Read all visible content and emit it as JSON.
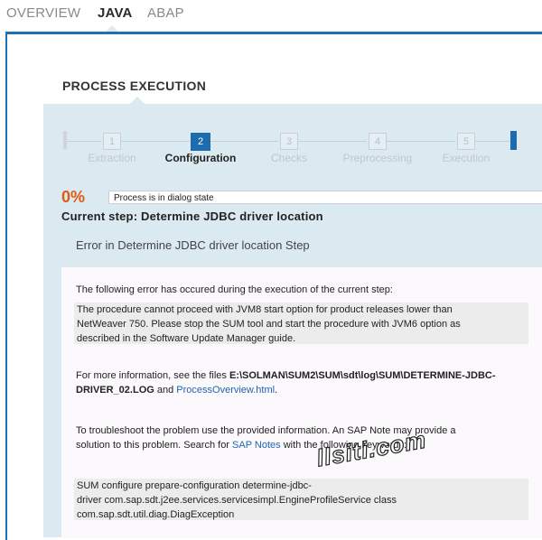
{
  "tabs": [
    {
      "label": "OVERVIEW",
      "active": false
    },
    {
      "label": "JAVA",
      "active": true
    },
    {
      "label": "ABAP",
      "active": false
    }
  ],
  "section_title": "PROCESS EXECUTION",
  "steps": [
    {
      "number": "1",
      "label": "Extraction",
      "active": false
    },
    {
      "number": "2",
      "label": "Configuration",
      "active": true
    },
    {
      "number": "3",
      "label": "Checks",
      "active": false
    },
    {
      "number": "4",
      "label": "Preprocessing",
      "active": false
    },
    {
      "number": "5",
      "label": "Execution",
      "active": false
    }
  ],
  "progress": {
    "percent": "0%",
    "status": "Process is in dialog state"
  },
  "current_step": "Current step: Determine JDBC driver location",
  "error_title": "Error in Determine JDBC driver location Step",
  "messages": {
    "intro": "The following error has occured during the execution of the current step:",
    "error_lines": [
      "The procedure cannot proceed with JVM8 start option for product releases lower than",
      "NetWeaver 750. Please stop the SUM tool and start the procedure with JVM6 option as",
      "described in the Software Update Manager guide."
    ],
    "more_info_prefix": "For more information, see the files ",
    "log_path_line1": "E:\\SOLMAN\\SUM2\\SUM\\sdt\\log\\SUM\\DETERMINE-JDBC-",
    "log_path_line2": "DRIVER_02.LOG",
    "and_text": " and ",
    "process_overview_link": "ProcessOverview.html",
    "period": ".",
    "troubleshoot_line1": "To troubleshoot the problem use the provided information. An SAP Note may provide a",
    "troubleshoot_line2_prefix": "solution to this problem. Search for ",
    "sap_notes_link": "SAP Notes",
    "troubleshoot_line2_suffix": " with the following keywords:",
    "keywords_lines": [
      "SUM  configure  prepare-configuration  determine-jdbc-",
      "driver  com.sap.sdt.j2ee.services.servicesimpl.EngineProfileService  class",
      "com.sap.sdt.util.diag.DiagException"
    ]
  },
  "watermark": "llsiti.com",
  "colors": {
    "accent": "#1e6bb0",
    "progress": "#e05b12",
    "panel": "#dbe9f1"
  }
}
